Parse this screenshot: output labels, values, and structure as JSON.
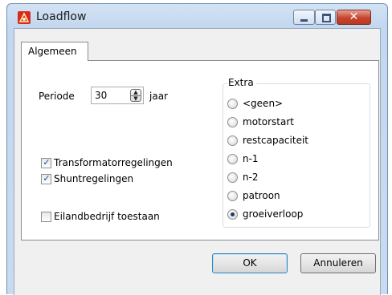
{
  "window": {
    "title": "Loadflow"
  },
  "tabs": [
    {
      "label": "Algemeen"
    }
  ],
  "periode": {
    "label": "Periode",
    "value": "30",
    "unit": "jaar"
  },
  "checkboxes": [
    {
      "label": "Transformatorregelingen",
      "checked": true
    },
    {
      "label": "Shuntregelingen",
      "checked": true
    },
    {
      "label": "Eilandbedrijf toestaan",
      "checked": false
    }
  ],
  "extra": {
    "title": "Extra",
    "options": [
      "<geen>",
      "motorstart",
      "restcapaciteit",
      "n-1",
      "n-2",
      "patroon",
      "groeiverloop"
    ],
    "selected": "groeiverloop"
  },
  "buttons": {
    "ok": "OK",
    "cancel": "Annuleren"
  },
  "caption_buttons": {
    "close": "✕"
  },
  "colors": {
    "accent": "#3c7fb1",
    "close": "#c7432d"
  },
  "icons": {
    "app": "loadflow-app-icon"
  }
}
